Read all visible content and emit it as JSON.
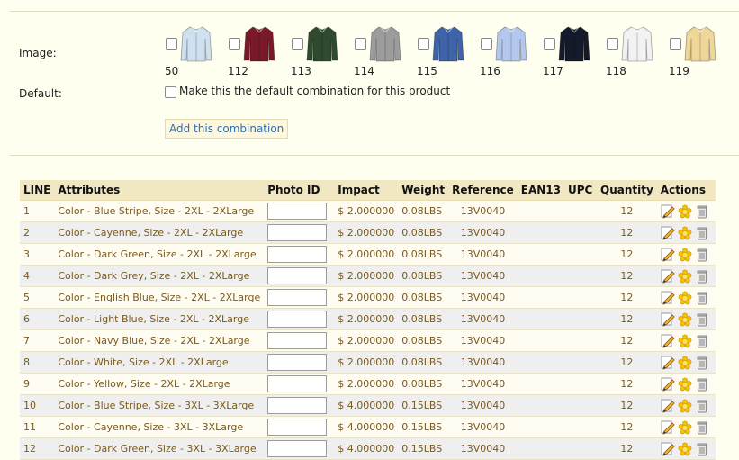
{
  "form": {
    "image_label": "Image:",
    "default_label": "Default:",
    "default_checkbox_text": "Make this the default combination for this product",
    "add_button": "Add this combination"
  },
  "images": [
    {
      "id": "50",
      "color": "#cfe0f0"
    },
    {
      "id": "112",
      "color": "#7a1a28"
    },
    {
      "id": "113",
      "color": "#2f4a2e"
    },
    {
      "id": "114",
      "color": "#9c9c9c"
    },
    {
      "id": "115",
      "color": "#3f63a8"
    },
    {
      "id": "116",
      "color": "#b4c8ee"
    },
    {
      "id": "117",
      "color": "#151a2a"
    },
    {
      "id": "118",
      "color": "#f2f2f2"
    },
    {
      "id": "119",
      "color": "#efd79a"
    }
  ],
  "table": {
    "headers": [
      "LINE",
      "Attributes",
      "Photo ID",
      "Impact",
      "Weight",
      "Reference",
      "EAN13",
      "UPC",
      "Quantity",
      "Actions"
    ],
    "rows": [
      {
        "line": "1",
        "attributes": "Color - Blue Stripe, Size - 2XL - 2XLarge",
        "impact": "$ 2.000000",
        "weight": "0.08LBS",
        "reference": "13V0040",
        "ean13": "",
        "upc": "",
        "quantity": "12"
      },
      {
        "line": "2",
        "attributes": "Color - Cayenne, Size - 2XL - 2XLarge",
        "impact": "$ 2.000000",
        "weight": "0.08LBS",
        "reference": "13V0040",
        "ean13": "",
        "upc": "",
        "quantity": "12"
      },
      {
        "line": "3",
        "attributes": "Color - Dark Green, Size - 2XL - 2XLarge",
        "impact": "$ 2.000000",
        "weight": "0.08LBS",
        "reference": "13V0040",
        "ean13": "",
        "upc": "",
        "quantity": "12"
      },
      {
        "line": "4",
        "attributes": "Color - Dark Grey, Size - 2XL - 2XLarge",
        "impact": "$ 2.000000",
        "weight": "0.08LBS",
        "reference": "13V0040",
        "ean13": "",
        "upc": "",
        "quantity": "12"
      },
      {
        "line": "5",
        "attributes": "Color - English Blue, Size - 2XL - 2XLarge",
        "impact": "$ 2.000000",
        "weight": "0.08LBS",
        "reference": "13V0040",
        "ean13": "",
        "upc": "",
        "quantity": "12"
      },
      {
        "line": "6",
        "attributes": "Color - Light Blue, Size - 2XL - 2XLarge",
        "impact": "$ 2.000000",
        "weight": "0.08LBS",
        "reference": "13V0040",
        "ean13": "",
        "upc": "",
        "quantity": "12"
      },
      {
        "line": "7",
        "attributes": "Color - Navy Blue, Size - 2XL - 2XLarge",
        "impact": "$ 2.000000",
        "weight": "0.08LBS",
        "reference": "13V0040",
        "ean13": "",
        "upc": "",
        "quantity": "12"
      },
      {
        "line": "8",
        "attributes": "Color - White, Size - 2XL - 2XLarge",
        "impact": "$ 2.000000",
        "weight": "0.08LBS",
        "reference": "13V0040",
        "ean13": "",
        "upc": "",
        "quantity": "12"
      },
      {
        "line": "9",
        "attributes": "Color - Yellow, Size - 2XL - 2XLarge",
        "impact": "$ 2.000000",
        "weight": "0.08LBS",
        "reference": "13V0040",
        "ean13": "",
        "upc": "",
        "quantity": "12"
      },
      {
        "line": "10",
        "attributes": "Color - Blue Stripe, Size - 3XL - 3XLarge",
        "impact": "$ 4.000000",
        "weight": "0.15LBS",
        "reference": "13V0040",
        "ean13": "",
        "upc": "",
        "quantity": "12"
      },
      {
        "line": "11",
        "attributes": "Color - Cayenne, Size - 3XL - 3XLarge",
        "impact": "$ 4.000000",
        "weight": "0.15LBS",
        "reference": "13V0040",
        "ean13": "",
        "upc": "",
        "quantity": "12"
      },
      {
        "line": "12",
        "attributes": "Color - Dark Green, Size - 3XL - 3XLarge",
        "impact": "$ 4.000000",
        "weight": "0.15LBS",
        "reference": "13V0040",
        "ean13": "",
        "upc": "",
        "quantity": "12"
      }
    ],
    "row_actions": [
      "edit-pencil-icon",
      "make-default-star-icon",
      "delete-trash-icon"
    ]
  },
  "colors": {
    "background": "#fffff0",
    "header_bg": "#f1e7c3",
    "link_blue": "#2f6fae",
    "cell_text": "#7b5a1c"
  }
}
